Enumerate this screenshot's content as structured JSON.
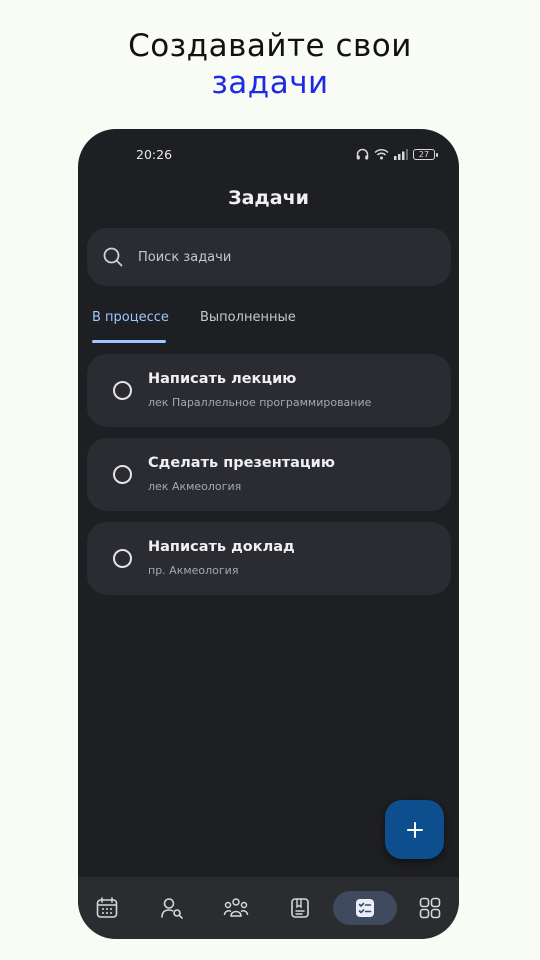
{
  "headline": {
    "line1": "Создавайте свои",
    "line2": "задачи"
  },
  "status": {
    "time": "20:26",
    "battery": "27"
  },
  "page": {
    "title": "Задачи"
  },
  "search": {
    "placeholder": "Поиск задачи"
  },
  "tabs": [
    {
      "label": "В процессе",
      "active": true
    },
    {
      "label": "Выполненные",
      "active": false
    }
  ],
  "tasks": [
    {
      "title": "Написать лекцию",
      "subtitle": "лек Параллельное программирование"
    },
    {
      "title": "Сделать презентацию",
      "subtitle": "лек Акмеология"
    },
    {
      "title": "Написать доклад",
      "subtitle": "пр. Акмеология"
    }
  ],
  "fab": {
    "icon": "plus-icon"
  },
  "nav": [
    {
      "icon": "calendar-icon",
      "active": false
    },
    {
      "icon": "person-search-icon",
      "active": false
    },
    {
      "icon": "groups-icon",
      "active": false
    },
    {
      "icon": "book-icon",
      "active": false
    },
    {
      "icon": "checklist-icon",
      "active": true
    },
    {
      "icon": "apps-grid-icon",
      "active": false
    }
  ],
  "colors": {
    "background": "#f8fcf4",
    "accent_headline": "#1f2ae6",
    "phone_bg": "#1e1f22",
    "card_bg": "#2a2c31",
    "tab_active": "#9cc6ff",
    "fab": "#0d4f8e",
    "nav_active": "#3f4a5e"
  }
}
